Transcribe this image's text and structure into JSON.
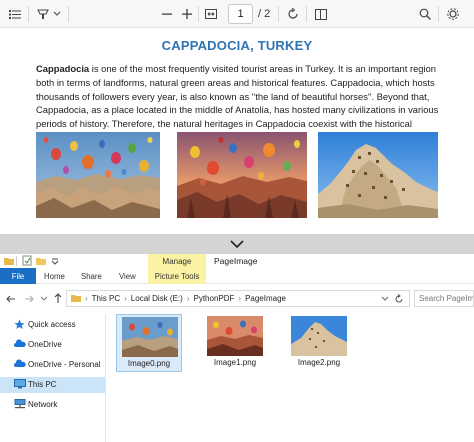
{
  "pdf_viewer": {
    "page_current": "1",
    "page_total": "/ 2",
    "document": {
      "title": "CAPPADOCIA, TURKEY",
      "lead_bold": "Cappadocia",
      "body": " is one of the most frequently visited tourist areas in Turkey. It is an important region both in terms of landforms, natural green areas and historical features. Cappadocia, which hosts thousands of followers every year, is also known as ''the land of beautiful horses''. Beyond that, Cappadocia, as a place located in the middle of Anatolia, has hosted many civilizations in various periods of history. Therefore, the natural heritages in Cappadocia coexist with the historical heritages."
    },
    "toolbar_icons": [
      "list-icon",
      "highlight-pen-icon",
      "chevron-down-icon",
      "minus-icon",
      "plus-icon",
      "fit-page-icon",
      "rotate-icon",
      "page-view-icon",
      "search-icon",
      "settings-icon"
    ]
  },
  "explorer": {
    "context_tab_group": "Manage",
    "window_title": "PageImage",
    "ribbon_tabs": [
      "File",
      "Home",
      "Share",
      "View",
      "Picture Tools"
    ],
    "breadcrumb": [
      "This PC",
      "Local Disk (E:)",
      "PythonPDF",
      "PageImage"
    ],
    "search_placeholder": "Search PageImage",
    "nav_items": [
      {
        "label": "Quick access",
        "icon": "star-icon"
      },
      {
        "label": "OneDrive",
        "icon": "cloud-icon"
      },
      {
        "label": "OneDrive - Personal",
        "icon": "cloud-icon"
      },
      {
        "label": "This PC",
        "icon": "computer-icon"
      },
      {
        "label": "Network",
        "icon": "network-icon"
      }
    ],
    "files": [
      {
        "name": "Image0.png"
      },
      {
        "name": "Image1.png"
      },
      {
        "name": "Image2.png"
      }
    ],
    "colors": {
      "accent": "#1a6fc4",
      "manage": "#fbf3a4",
      "selection": "#cce4f7",
      "title": "#2e74b5"
    }
  }
}
